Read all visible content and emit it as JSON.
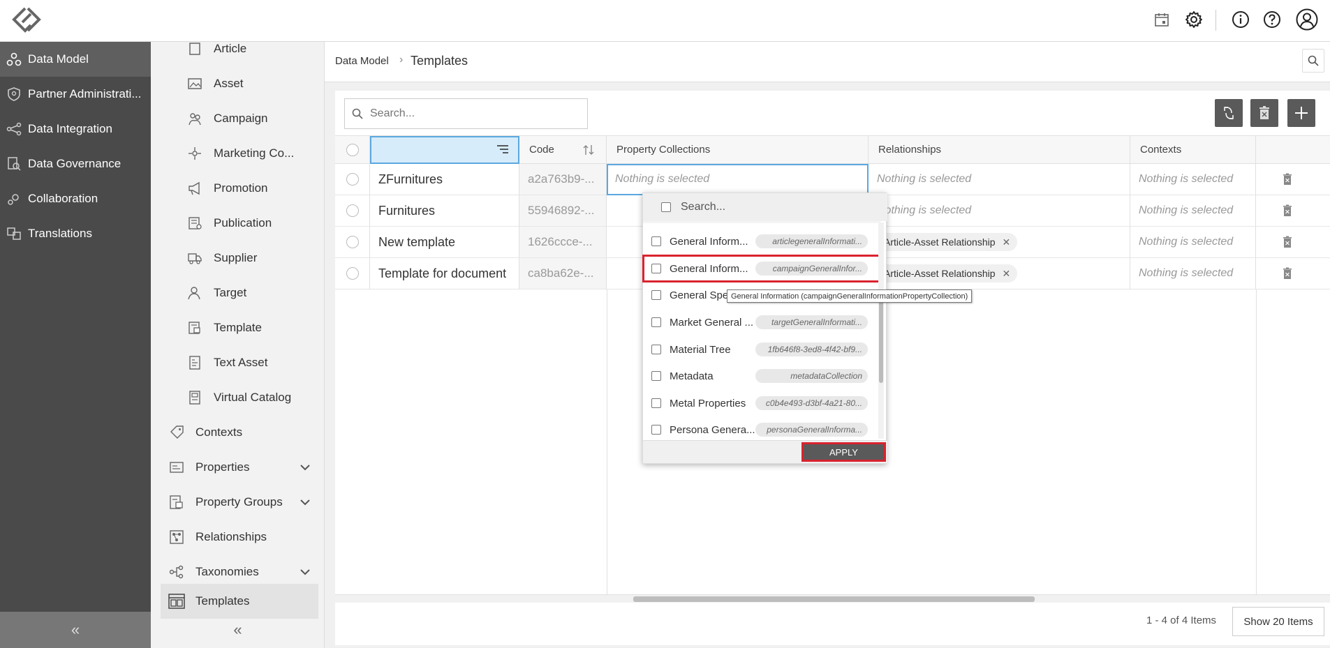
{
  "topbar": {
    "icons": [
      "logo-icon",
      "calendar-icon",
      "gear-icon",
      "info-icon",
      "help-icon",
      "user-icon"
    ]
  },
  "leftnav": {
    "items": [
      {
        "label": "Data Model",
        "icon": "data-model-icon",
        "active": true
      },
      {
        "label": "Partner Administrati...",
        "icon": "partner-icon"
      },
      {
        "label": "Data Integration",
        "icon": "integration-icon"
      },
      {
        "label": "Data Governance",
        "icon": "governance-icon"
      },
      {
        "label": "Collaboration",
        "icon": "collaboration-icon"
      },
      {
        "label": "Translations",
        "icon": "translations-icon"
      }
    ],
    "collapse": "«"
  },
  "subnav": {
    "items": [
      {
        "label": "Article"
      },
      {
        "label": "Asset"
      },
      {
        "label": "Campaign"
      },
      {
        "label": "Marketing Co..."
      },
      {
        "label": "Promotion"
      },
      {
        "label": "Publication"
      },
      {
        "label": "Supplier"
      },
      {
        "label": "Target"
      },
      {
        "label": "Template"
      },
      {
        "label": "Text Asset"
      },
      {
        "label": "Virtual Catalog"
      },
      {
        "label": "Contexts"
      },
      {
        "label": "Properties"
      },
      {
        "label": "Property Groups"
      },
      {
        "label": "Relationships"
      },
      {
        "label": "Taxonomies"
      },
      {
        "label": "Templates"
      }
    ],
    "collapse": "«"
  },
  "breadcrumb": {
    "root": "Data Model",
    "sep": "›",
    "current": "Templates"
  },
  "toolbar": {
    "search_placeholder": "Search..."
  },
  "grid": {
    "columns": [
      "",
      "Code",
      "Property Collections",
      "Relationships",
      "Contexts"
    ],
    "rows": [
      {
        "name": "ZFurnitures",
        "code": "a2a763b9-...",
        "property_collections": "Nothing is selected",
        "relationships": "Nothing is selected",
        "contexts": "Nothing is selected"
      },
      {
        "name": "Furnitures",
        "code": "55946892-...",
        "property_collections": "",
        "relationships": "Nothing is selected",
        "contexts": "Nothing is selected"
      },
      {
        "name": "New template",
        "code": "1626ccce-...",
        "property_collections": "",
        "relationships": "Article-Asset Relationship",
        "contexts": "Nothing is selected"
      },
      {
        "name": "Template for document",
        "code": "ca8ba62e-...",
        "property_collections": "",
        "relationships": "Article-Asset Relationship",
        "contexts": "Nothing is selected"
      }
    ]
  },
  "pager": {
    "summary": "1 - 4 of 4 Items",
    "show": "Show 20 Items"
  },
  "dropdown": {
    "search_placeholder": "Search...",
    "items": [
      {
        "name": "General Inform...",
        "code": "articlegeneralInformati..."
      },
      {
        "name": "General Inform...",
        "code": "campaignGeneralInfor..."
      },
      {
        "name": "General Spe",
        "code": ""
      },
      {
        "name": "Market General ...",
        "code": "targetGeneralInformati..."
      },
      {
        "name": "Material Tree",
        "code": "1fb646f8-3ed8-4f42-bf9..."
      },
      {
        "name": "Metadata",
        "code": "metadataCollection"
      },
      {
        "name": "Metal Properties",
        "code": "c0b4e493-d3bf-4a21-80..."
      },
      {
        "name": "Persona Genera...",
        "code": "personaGeneralInforma..."
      }
    ],
    "apply": "APPLY",
    "tooltip": "General Information (campaignGeneralInformationPropertyCollection)"
  },
  "colors": {
    "accent": "#d9232e",
    "nav_bg": "#4a4a4a",
    "button_bg": "#5a5a5a"
  }
}
